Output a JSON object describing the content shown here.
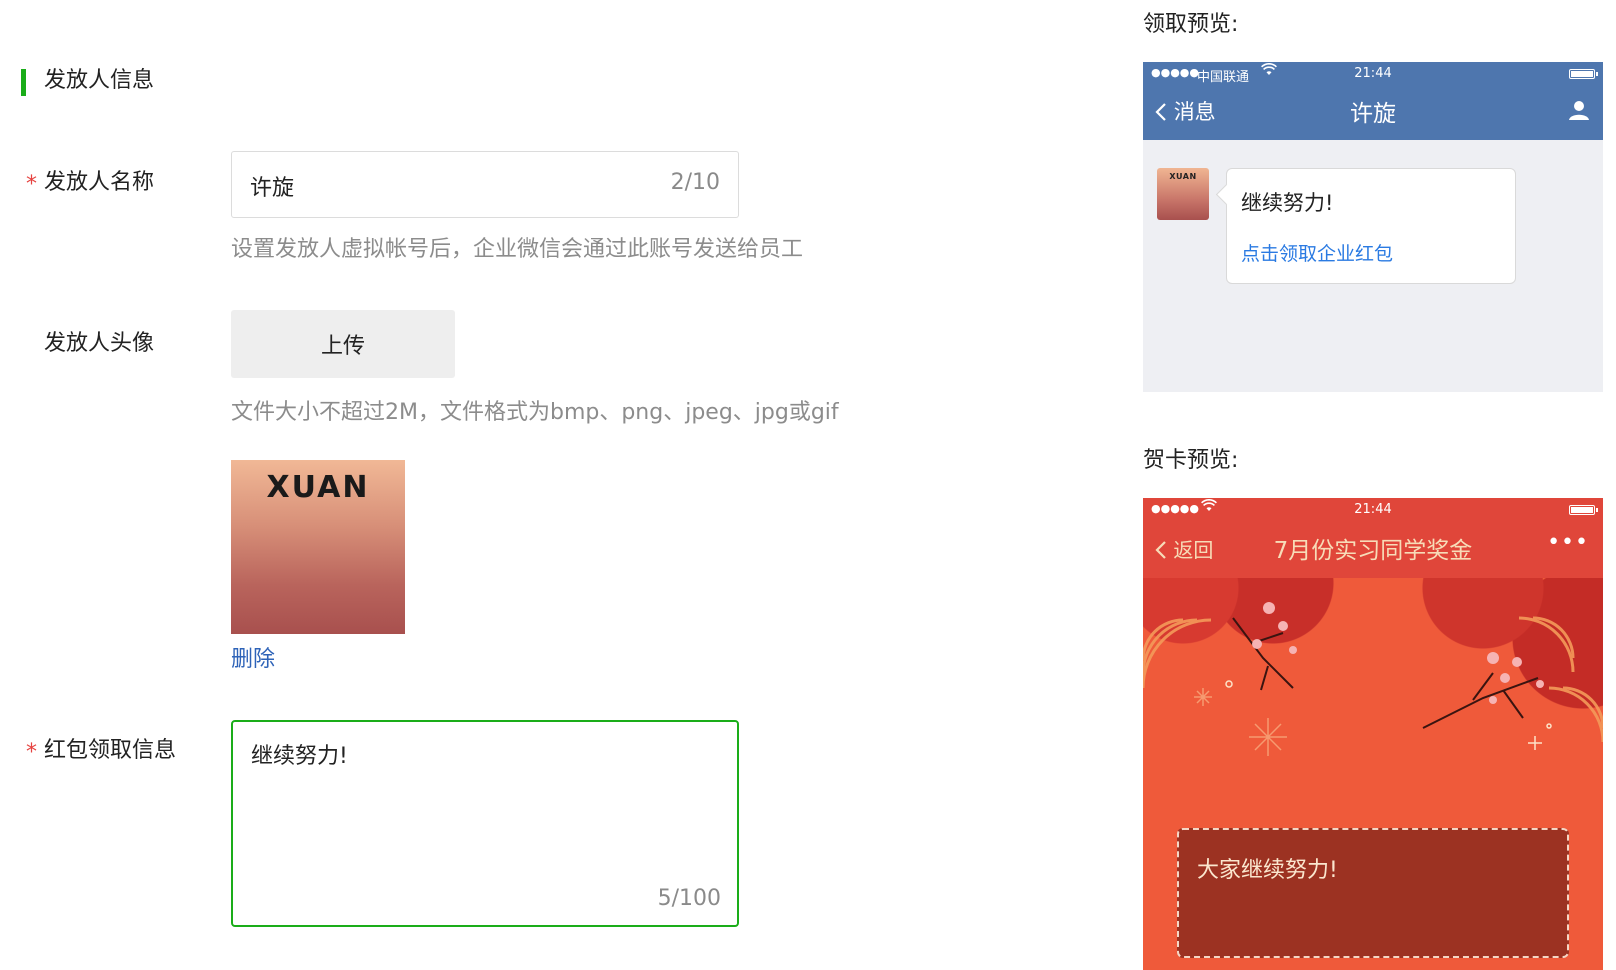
{
  "section": {
    "title": "发放人信息"
  },
  "form": {
    "required_mark": "*",
    "sender_name": {
      "label": "发放人名称",
      "value": "许旋",
      "count": "2/10",
      "hint": "设置发放人虚拟帐号后，企业微信会通过此账号发送给员工"
    },
    "sender_avatar": {
      "label": "发放人头像",
      "upload_label": "上传",
      "hint": "文件大小不超过2M，文件格式为bmp、png、jpeg、jpg或gif",
      "avatar_text": "XUAN",
      "delete_label": "删除"
    },
    "receive_info": {
      "label": "红包领取信息",
      "value": "继续努力!",
      "count": "5/100"
    }
  },
  "preview_receive": {
    "label": "领取预览:",
    "status": {
      "dots": "●●●●●",
      "carrier": "中国联通",
      "time": "21:44"
    },
    "nav": {
      "back": "消息",
      "title": "许旋"
    },
    "avatar_text": "XUAN",
    "bubble": {
      "text": "继续努力!",
      "link": "点击领取企业红包"
    },
    "colors": {
      "navbar": "#4e76ae",
      "background": "#eeeff3"
    }
  },
  "preview_card": {
    "label": "贺卡预览:",
    "status": {
      "dots": "●●●●●",
      "time": "21:44"
    },
    "nav": {
      "back": "返回",
      "title": "7月份实习同学奖金",
      "more": "•••"
    },
    "greeting": "大家继续努力!",
    "colors": {
      "navbar": "#e0463a",
      "background": "#ef5a3a",
      "title": "#f7dcb8"
    }
  },
  "colors": {
    "accent": "#1aad19",
    "required": "#e64340",
    "link": "#2e63b8"
  }
}
